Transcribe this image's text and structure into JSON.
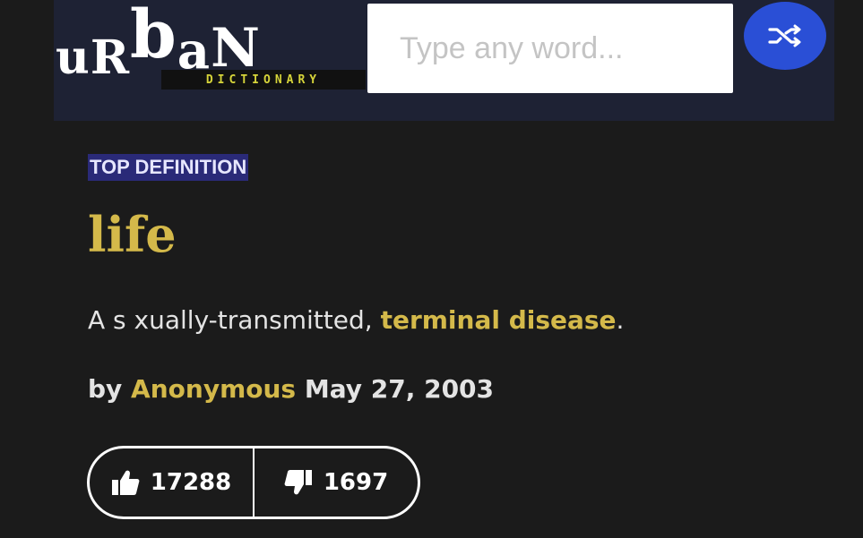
{
  "header": {
    "logo": {
      "word": "urban",
      "sub": "DICTIONARY"
    },
    "search": {
      "placeholder": "Type any word..."
    },
    "icons": {
      "random": "shuffle-icon"
    },
    "colors": {
      "bar": "#1e2234",
      "random_button": "#2a4fd6"
    }
  },
  "entry": {
    "badge": "TOP DEFINITION",
    "word": "life",
    "definition": {
      "prefix": "A s  xually-transmitted, ",
      "link": "terminal disease",
      "suffix": "."
    },
    "byline": {
      "by": "by",
      "author": "Anonymous",
      "date": "May 27, 2003"
    },
    "votes": {
      "up": "17288",
      "down": "1697",
      "up_icon": "thumbs-up-icon",
      "down_icon": "thumbs-down-icon"
    },
    "colors": {
      "accent": "#d4b94a",
      "badge_bg": "#2a2a78",
      "background": "#1b1b1b"
    }
  }
}
